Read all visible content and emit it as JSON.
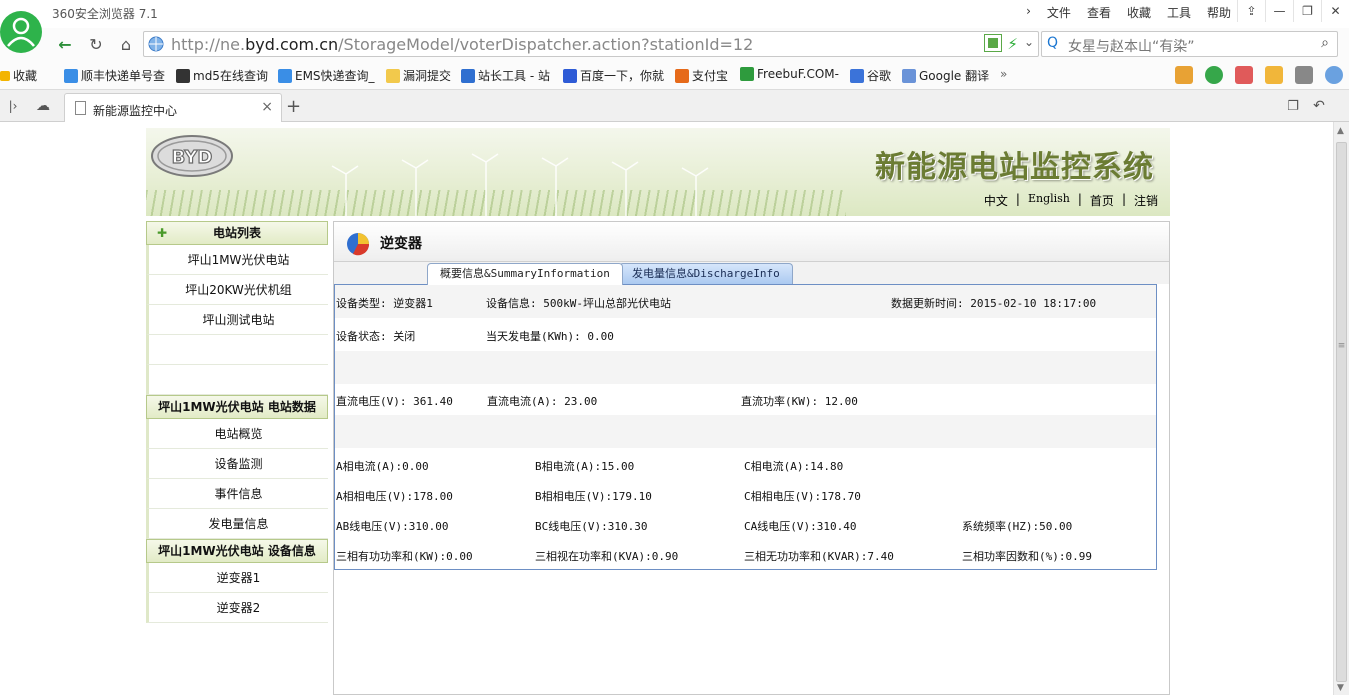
{
  "browser": {
    "app_title": "360安全浏览器 7.1",
    "menu": [
      "文件",
      "查看",
      "收藏",
      "工具",
      "帮助"
    ],
    "url_host_prefix": "http://ne.",
    "url_host_main": "byd.com.cn",
    "url_path": "/StorageModel/voterDispatcher.action?stationId=12",
    "search_placeholder": "女星与赵本山“有染”",
    "favorites": [
      "收藏",
      "顺丰快递单号查",
      "md5在线查询",
      "EMS快递查询_",
      "漏洞提交",
      "站长工具 - 站",
      "百度一下，你就",
      "支付宝",
      "FreebuF.COM-",
      "谷歌",
      "Google 翻译"
    ],
    "more_label": "»",
    "tab_title": "新能源监控中心",
    "tab_close": "×",
    "tab_new": "+"
  },
  "site": {
    "logo_text": "BYD",
    "title": "新能源电站监控系统",
    "toplinks": [
      "中文",
      "English",
      "首页",
      "注销"
    ],
    "separator": "|"
  },
  "leftmenu": {
    "station_list_title": "电站列表",
    "stations": [
      "坪山1MW光伏电站",
      "坪山20KW光伏机组",
      "坪山测试电站"
    ],
    "station_data_title": "坪山1MW光伏电站 电站数据",
    "station_data_items": [
      "电站概览",
      "设备监测",
      "事件信息",
      "发电量信息"
    ],
    "device_info_title": "坪山1MW光伏电站 设备信息",
    "devices": [
      "逆变器1",
      "逆变器2"
    ]
  },
  "panel": {
    "title": "逆变器",
    "tabs": [
      "概要信息&SummaryInformation",
      "发电量信息&DischargeInfo"
    ],
    "row1": {
      "device_type": "设备类型: 逆变器1",
      "device_info": "设备信息: 500kW-坪山总部光伏电站",
      "update_time": "数据更新时间: 2015-02-10 18:17:00"
    },
    "row2": {
      "status": "设备状态: 关闭",
      "daily_energy": "当天发电量(KWh): 0.00"
    },
    "row_dc": {
      "dc_voltage": "直流电压(V): 361.40",
      "dc_current": "直流电流(A): 23.00",
      "dc_power": "直流功率(KW): 12.00"
    },
    "row_current": {
      "a": "A相电流(A):0.00",
      "b": "B相电流(A):15.00",
      "c": "C相电流(A):14.80"
    },
    "row_phase_voltage": {
      "a": "A相相电压(V):178.00",
      "b": "B相相电压(V):179.10",
      "c": "C相相电压(V):178.70"
    },
    "row_line_voltage": {
      "ab": "AB线电压(V):310.00",
      "bc": "BC线电压(V):310.30",
      "ca": "CA线电压(V):310.40",
      "freq": "系统频率(HZ):50.00"
    },
    "row_power": {
      "active": "三相有功功率和(KW):0.00",
      "apparent": "三相视在功率和(KVA):0.90",
      "reactive": "三相无功功率和(KVAR):7.40",
      "pf": "三相功率因数和(%):0.99"
    }
  },
  "colors": {
    "banner_title": "#6b7c33",
    "menu_header_bg": "#e2ebc6",
    "tab_active_border": "#8fa7c9",
    "info_border": "#6d8fc4"
  }
}
